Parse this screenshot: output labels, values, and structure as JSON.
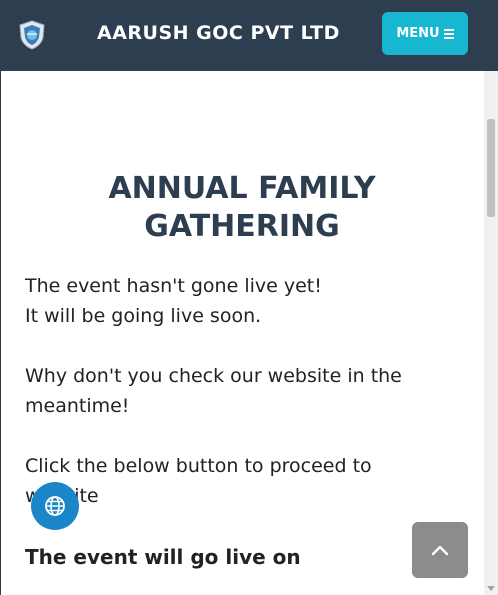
{
  "navbar": {
    "brand": "AARUSH GOC PVT LTD",
    "menu_label": "MENU",
    "logo_icon": "shield-logo-icon"
  },
  "main": {
    "title": "ANNUAL FAMILY GATHERING",
    "paragraph1_line1": "The event hasn't gone live yet!",
    "paragraph1_line2": "It will be going live soon.",
    "paragraph2": "Why don't you check our website in the meantime!",
    "paragraph3": "Click the below button to proceed to website",
    "subheading": "The event will go live on"
  },
  "buttons": {
    "website_icon": "globe-icon",
    "scroll_top_icon": "chevron-up-icon"
  },
  "colors": {
    "navbar_bg": "#2c3e50",
    "menu_bg": "#18b7d1",
    "globe_bg": "#1a86c8",
    "scroll_top_bg": "#8c8c8c"
  }
}
